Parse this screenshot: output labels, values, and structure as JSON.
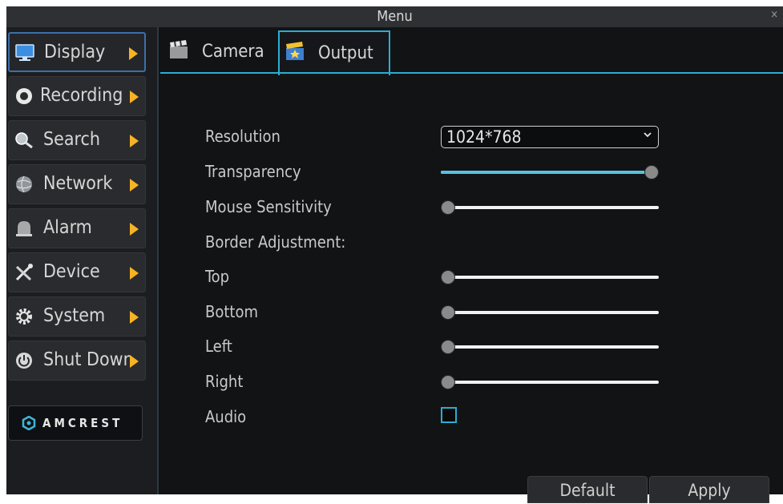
{
  "window": {
    "title": "Menu",
    "close_glyph": "×"
  },
  "sidebar": {
    "items": [
      {
        "label": "Display",
        "icon": "monitor-icon",
        "active": true
      },
      {
        "label": "Recording",
        "icon": "record-icon"
      },
      {
        "label": "Search",
        "icon": "search-icon"
      },
      {
        "label": "Network",
        "icon": "globe-icon"
      },
      {
        "label": "Alarm",
        "icon": "alarm-bell-icon"
      },
      {
        "label": "Device",
        "icon": "tools-icon"
      },
      {
        "label": "System",
        "icon": "gear-icon"
      },
      {
        "label": "Shut Down",
        "icon": "power-icon"
      }
    ],
    "brand": "AMCREST"
  },
  "tabs": [
    {
      "label": "Camera",
      "icon": "clapperboard-icon",
      "active": false
    },
    {
      "label": "Output",
      "icon": "clapperboard-star-icon",
      "active": true
    }
  ],
  "output": {
    "resolution_label": "Resolution",
    "resolution_value": "1024*768",
    "transparency_label": "Transparency",
    "transparency_value": 1.0,
    "mouse_sensitivity_label": "Mouse Sensitivity",
    "mouse_sensitivity_value": 0.0,
    "border_adjustment_label": "Border Adjustment:",
    "top_label": "Top",
    "top_value": 0.0,
    "bottom_label": "Bottom",
    "bottom_value": 0.0,
    "left_label": "Left",
    "left_value": 0.0,
    "right_label": "Right",
    "right_value": 0.0,
    "audio_label": "Audio",
    "audio_checked": false
  },
  "buttons": {
    "default": "Default",
    "apply": "Apply"
  },
  "colors": {
    "accent": "#2aaed0",
    "arrow": "#f7b324",
    "background": "#121315"
  }
}
